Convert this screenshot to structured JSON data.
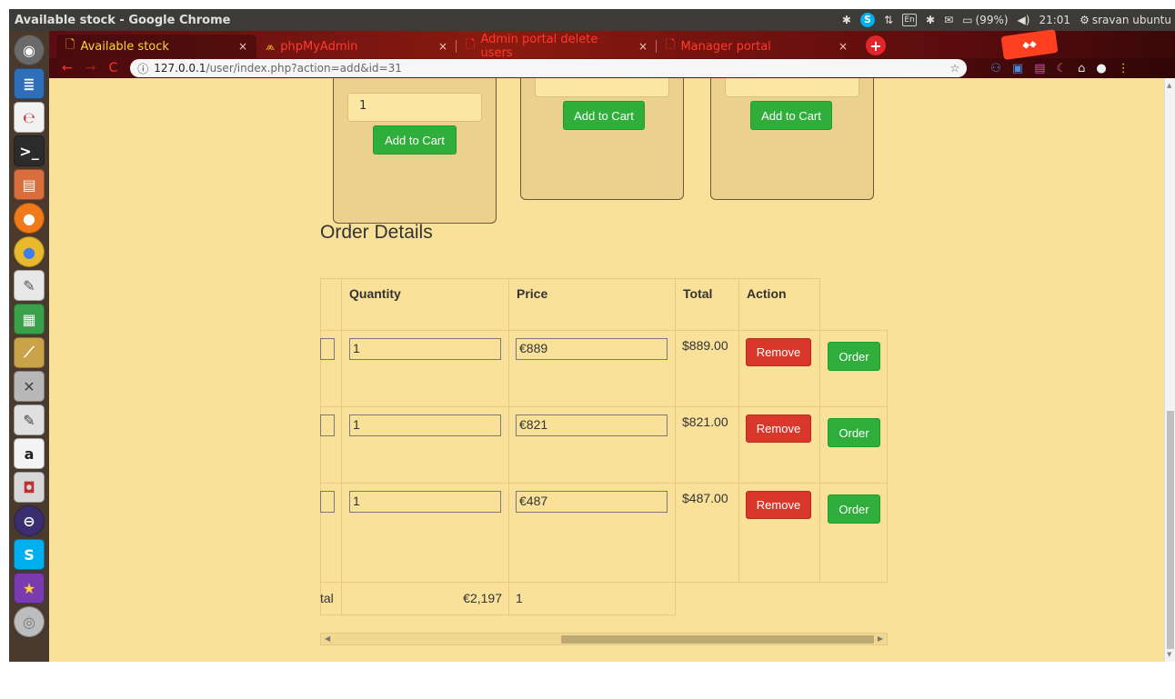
{
  "panel": {
    "window_title": "Available stock - Google Chrome",
    "battery": "(99%)",
    "clock": "21:01",
    "user": "sravan ubuntu",
    "keyboard": "En"
  },
  "tabs": [
    {
      "label": "Available stock",
      "active": true
    },
    {
      "label": "phpMyAdmin",
      "active": false
    },
    {
      "label": "Admin portal delete users",
      "active": false
    },
    {
      "label": "Manager portal",
      "active": false
    }
  ],
  "address": {
    "host": "127.0.0.1",
    "path": "/user/index.php?action=add&id=31"
  },
  "products": [
    {
      "qty": "1",
      "button": "Add to Cart"
    },
    {
      "qty": "",
      "button": "Add to Cart"
    },
    {
      "qty": "",
      "button": "Add to Cart"
    }
  ],
  "order": {
    "title": "Order Details",
    "columns": [
      "Quantity",
      "Price",
      "Total",
      "Action"
    ],
    "rows": [
      {
        "qty": "1",
        "price": "€889",
        "total": "$889.00",
        "remove": "Remove",
        "order": "Order"
      },
      {
        "qty": "1",
        "price": "€821",
        "total": "$821.00",
        "remove": "Remove",
        "order": "Order"
      },
      {
        "qty": "1",
        "price": "€487",
        "total": "$487.00",
        "remove": "Remove",
        "order": "Order"
      }
    ],
    "footer": {
      "label": "tal",
      "amount": "€2,197",
      "count": "1"
    }
  },
  "colors": {
    "page_bg": "#f9e19a",
    "green_button": "#2fae3c",
    "red_button": "#d9372a"
  }
}
